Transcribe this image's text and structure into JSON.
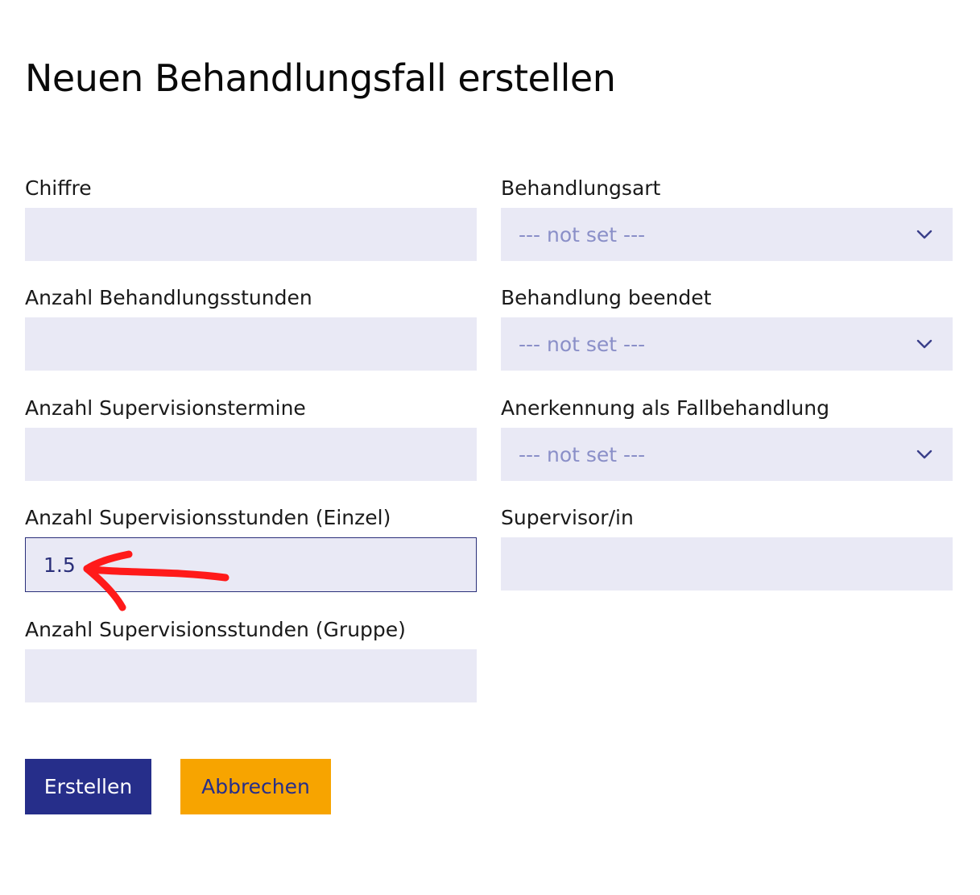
{
  "page": {
    "title": "Neuen Behandlungsfall erstellen"
  },
  "form": {
    "chiffre": {
      "label": "Chiffre",
      "value": ""
    },
    "behandlungsstunden": {
      "label": "Anzahl Behandlungsstunden",
      "value": ""
    },
    "supervisionstermine": {
      "label": "Anzahl Supervisionstermine",
      "value": ""
    },
    "supervisionsstunden_einzel": {
      "label": "Anzahl Supervisionsstunden (Einzel)",
      "value": "1.5"
    },
    "supervisionsstunden_gruppe": {
      "label": "Anzahl Supervisionsstunden (Gruppe)",
      "value": ""
    },
    "behandlungsart": {
      "label": "Behandlungsart",
      "selected": "--- not set ---"
    },
    "behandlung_beendet": {
      "label": "Behandlung beendet",
      "selected": "--- not set ---"
    },
    "anerkennung": {
      "label": "Anerkennung als Fallbehandlung",
      "selected": "--- not set ---"
    },
    "supervisor": {
      "label": "Supervisor/in",
      "value": ""
    }
  },
  "actions": {
    "submit_label": "Erstellen",
    "cancel_label": "Abbrechen"
  },
  "colors": {
    "field_background": "#e9e9f5",
    "primary": "#262e8a",
    "accent": "#f7a400",
    "placeholder": "#8a8fc8",
    "annotation": "#ff1a1a"
  },
  "icons": {
    "select_indicator": "chevron-down-icon",
    "annotation": "red-arrow-icon"
  }
}
